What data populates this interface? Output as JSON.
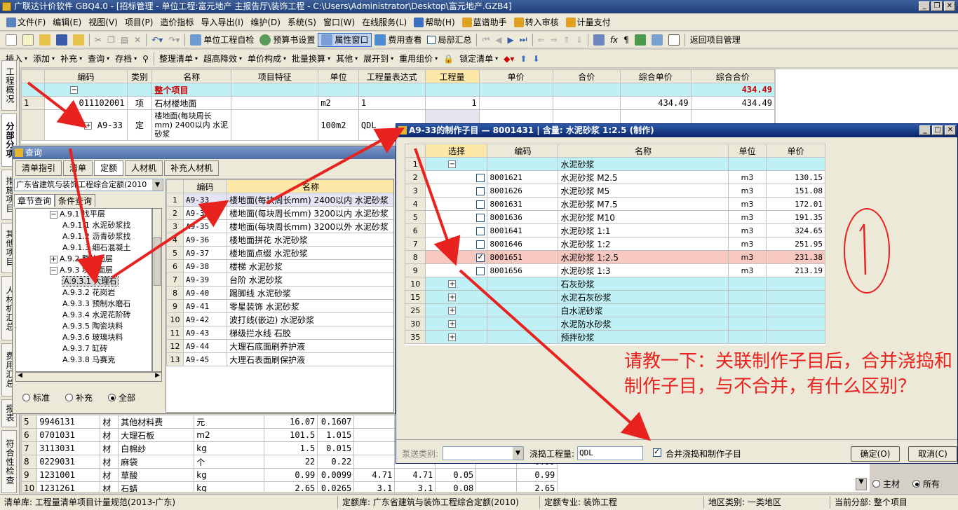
{
  "window": {
    "title": "广联达计价软件 GBQ4.0 - [招标管理 - 单位工程:富元地产 主报告厅\\装饰工程 - C:\\Users\\Administrator\\Desktop\\富元地产.GZB4]",
    "controls": [
      "_",
      "❐",
      "✕"
    ]
  },
  "menu": [
    "文件(F)",
    "编辑(E)",
    "视图(V)",
    "项目(P)",
    "造价指标",
    "导入导出(I)",
    "维护(D)",
    "系统(S)",
    "窗口(W)",
    "在线服务(L)",
    "帮助(H)",
    "蓝谱助手",
    "转入审核",
    "计量支付"
  ],
  "toolbar1": {
    "self_check": "单位工程自检",
    "budget_settings": "预算书设置",
    "property_window": "属性窗口",
    "fee_view": "费用查看",
    "local_summary": "局部汇总",
    "return_project": "返回项目管理"
  },
  "toolbar2": [
    "插入",
    "添加",
    "补充",
    "查询",
    "存档",
    "整理清单",
    "超高降效",
    "单价构成",
    "批量换算",
    "其他",
    "展开到",
    "重用组价",
    "锁定清单"
  ],
  "left_tabs": [
    "工程概况",
    "分部分项",
    "措施项目",
    "其他项目",
    "人材机汇总",
    "费用汇总",
    "报表",
    "符合性检查"
  ],
  "main_grid": {
    "headers": [
      "编码",
      "类别",
      "名称",
      "项目特征",
      "单位",
      "工程量表达式",
      "工程量",
      "单价",
      "合价",
      "综合单价",
      "综合合价"
    ],
    "rows": [
      {
        "no": "",
        "code": "",
        "type": "",
        "name": "整个项目",
        "unit": "",
        "expr": "",
        "qty": "",
        "unit_price": "",
        "total": "",
        "comp_price": "",
        "comp_total": "434.49"
      },
      {
        "no": "1",
        "code": "011102001",
        "type": "项",
        "name": "石材楼地面",
        "unit": "m2",
        "expr": "1",
        "qty": "1",
        "unit_price": "",
        "total": "",
        "comp_price": "434.49",
        "comp_total": "434.49"
      },
      {
        "no": "",
        "code": "A9-33",
        "type": "定",
        "name": "楼地面(每块周长mm) 2400以内 水泥砂浆",
        "unit": "100m2",
        "expr": "QDL",
        "qty": "",
        "unit_price": "",
        "total": "",
        "comp_price": "",
        "comp_total": ""
      }
    ]
  },
  "query_panel": {
    "title": "查询",
    "tabs": [
      "清单指引",
      "清单",
      "定额",
      "人材机",
      "补充人材机"
    ],
    "active_tab": "定额",
    "library": "广东省建筑与装饰工程综合定额(2010",
    "subtabs": [
      "章节查询",
      "条件查询"
    ],
    "tree": [
      {
        "indent": 1,
        "exp": "−",
        "label": "A.9.1 找平层"
      },
      {
        "indent": 2,
        "exp": "",
        "label": "A.9.1.1 水泥砂浆找"
      },
      {
        "indent": 2,
        "exp": "",
        "label": "A.9.1.2 沥青砂浆找"
      },
      {
        "indent": 2,
        "exp": "",
        "label": "A.9.1.3 细石混凝土"
      },
      {
        "indent": 1,
        "exp": "+",
        "label": "A.9.2 整体面层"
      },
      {
        "indent": 1,
        "exp": "−",
        "label": "A.9.3 块料面层"
      },
      {
        "indent": 2,
        "exp": "",
        "label": "A.9.3.1 大理石",
        "selected": true
      },
      {
        "indent": 2,
        "exp": "",
        "label": "A.9.3.2 花岗岩"
      },
      {
        "indent": 2,
        "exp": "",
        "label": "A.9.3.3 预制水磨石"
      },
      {
        "indent": 2,
        "exp": "",
        "label": "A.9.3.4 水泥花阶砖"
      },
      {
        "indent": 2,
        "exp": "",
        "label": "A.9.3.5 陶瓷块料"
      },
      {
        "indent": 2,
        "exp": "",
        "label": "A.9.3.6 玻璃块料"
      },
      {
        "indent": 2,
        "exp": "",
        "label": "A.9.3.7 缸砖"
      },
      {
        "indent": 2,
        "exp": "",
        "label": "A.9.3.8 马赛克"
      }
    ],
    "radios": [
      "标准",
      "补充",
      "全部"
    ],
    "radio_selected": "全部",
    "list_headers": [
      "编码",
      "名称"
    ],
    "list": [
      {
        "no": "1",
        "code": "A9-33",
        "name": "楼地面(每块周长mm) 2400以内 水泥砂浆"
      },
      {
        "no": "2",
        "code": "A9-34",
        "name": "楼地面(每块周长mm) 3200以内 水泥砂浆"
      },
      {
        "no": "3",
        "code": "A9-35",
        "name": "楼地面(每块周长mm) 3200以外 水泥砂浆"
      },
      {
        "no": "4",
        "code": "A9-36",
        "name": "楼地面拼花 水泥砂浆"
      },
      {
        "no": "5",
        "code": "A9-37",
        "name": "楼地面点缀 水泥砂浆"
      },
      {
        "no": "6",
        "code": "A9-38",
        "name": "楼梯 水泥砂浆"
      },
      {
        "no": "7",
        "code": "A9-39",
        "name": "台阶 水泥砂浆"
      },
      {
        "no": "8",
        "code": "A9-40",
        "name": "踢脚线 水泥砂浆"
      },
      {
        "no": "9",
        "code": "A9-41",
        "name": "零星装饰 水泥砂浆"
      },
      {
        "no": "10",
        "code": "A9-42",
        "name": "波打线(嵌边) 水泥砂浆"
      },
      {
        "no": "11",
        "code": "A9-43",
        "name": "梯级拦水线 石胶"
      },
      {
        "no": "12",
        "code": "A9-44",
        "name": "大理石底面刷养护液"
      },
      {
        "no": "13",
        "code": "A9-45",
        "name": "大理石表面刷保护液"
      }
    ]
  },
  "bottom_grid": {
    "rows": [
      {
        "no": "5",
        "code": "9946131",
        "type": "材",
        "name": "其他材料费",
        "unit": "元",
        "a": "16.07",
        "b": "0.1607"
      },
      {
        "no": "6",
        "code": "0701031",
        "type": "材",
        "name": "大理石板",
        "unit": "m2",
        "a": "101.5",
        "b": "1.015"
      },
      {
        "no": "7",
        "code": "3113031",
        "type": "材",
        "name": "白棉纱",
        "unit": "kg",
        "a": "1.5",
        "b": "0.015"
      },
      {
        "no": "8",
        "code": "0229031",
        "type": "材",
        "name": "麻袋",
        "unit": "个",
        "a": "22",
        "b": "0.22"
      },
      {
        "no": "9",
        "code": "1231001",
        "type": "材",
        "name": "草酸",
        "unit": "kg",
        "a": "0.99",
        "b": "0.0099"
      },
      {
        "no": "10",
        "code": "1231261",
        "type": "材",
        "name": "石蜡",
        "unit": "kg",
        "a": "2.65",
        "b": "0.0265"
      }
    ],
    "extra_cols": [
      [
        "",
        "",
        "",
        "",
        "0.99"
      ],
      [
        "4.71",
        "4.71",
        "0.05",
        "",
        "0.99"
      ],
      [
        "3.1",
        "3.1",
        "0.08",
        "",
        "2.65"
      ]
    ],
    "radios": [
      "主材",
      "所有"
    ],
    "radio_selected": "所有"
  },
  "dialog": {
    "title": "A9-33的制作子目 — 8001431 | 含量: 水泥砂浆 1:2.5 (制作)",
    "headers": [
      "选择",
      "编码",
      "名称",
      "单位",
      "单价"
    ],
    "rows": [
      {
        "no": "1",
        "exp": "−",
        "check": null,
        "code": "",
        "name": "水泥砂浆",
        "unit": "",
        "price": "",
        "group": true
      },
      {
        "no": "2",
        "exp": "",
        "check": false,
        "code": "8001621",
        "name": "水泥砂浆 M2.5",
        "unit": "m3",
        "price": "130.15"
      },
      {
        "no": "3",
        "exp": "",
        "check": false,
        "code": "8001626",
        "name": "水泥砂浆 M5",
        "unit": "m3",
        "price": "151.08"
      },
      {
        "no": "4",
        "exp": "",
        "check": false,
        "code": "8001631",
        "name": "水泥砂浆 M7.5",
        "unit": "m3",
        "price": "172.01"
      },
      {
        "no": "5",
        "exp": "",
        "check": false,
        "code": "8001636",
        "name": "水泥砂浆 M10",
        "unit": "m3",
        "price": "191.35"
      },
      {
        "no": "6",
        "exp": "",
        "check": false,
        "code": "8001641",
        "name": "水泥砂浆 1:1",
        "unit": "m3",
        "price": "324.65"
      },
      {
        "no": "7",
        "exp": "",
        "check": false,
        "code": "8001646",
        "name": "水泥砂浆 1:2",
        "unit": "m3",
        "price": "251.95"
      },
      {
        "no": "8",
        "exp": "",
        "check": true,
        "code": "8001651",
        "name": "水泥砂浆 1:2.5",
        "unit": "m3",
        "price": "231.38",
        "selected": true
      },
      {
        "no": "9",
        "exp": "",
        "check": false,
        "code": "8001656",
        "name": "水泥砂浆 1:3",
        "unit": "m3",
        "price": "213.19"
      },
      {
        "no": "10",
        "exp": "+",
        "check": null,
        "code": "",
        "name": "石灰砂浆",
        "unit": "",
        "price": "",
        "group": true
      },
      {
        "no": "15",
        "exp": "+",
        "check": null,
        "code": "",
        "name": "水泥石灰砂浆",
        "unit": "",
        "price": "",
        "group": true
      },
      {
        "no": "25",
        "exp": "+",
        "check": null,
        "code": "",
        "name": "白水泥砂浆",
        "unit": "",
        "price": "",
        "group": true
      },
      {
        "no": "30",
        "exp": "+",
        "check": null,
        "code": "",
        "name": "水泥防水砂浆",
        "unit": "",
        "price": "",
        "group": true
      },
      {
        "no": "35",
        "exp": "+",
        "check": null,
        "code": "",
        "name": "预拌砂浆",
        "unit": "",
        "price": "",
        "group": true
      }
    ],
    "pump_label": "泵送类别:",
    "pump_value": "",
    "pour_label": "浇捣工程量:",
    "pour_value": "QDL",
    "merge_label": "合并浇捣和制作子目",
    "merge_checked": true,
    "ok": "确定(O)",
    "cancel": "取消(C)"
  },
  "annotation": {
    "question": "请教一下：关联制作子目后，合并浇捣和制作子目，与不合并，有什么区别？",
    "circled": "1",
    "color": "#e8231f"
  },
  "status": {
    "bill_lib": "清单库: 工程量清单项目计量规范(2013-广东)",
    "quota_lib": "定额库: 广东省建筑与装饰工程综合定额(2010)",
    "quota_major": "定额专业: 装饰工程",
    "region": "地区类别: 一类地区",
    "current": "当前分部: 整个项目"
  }
}
